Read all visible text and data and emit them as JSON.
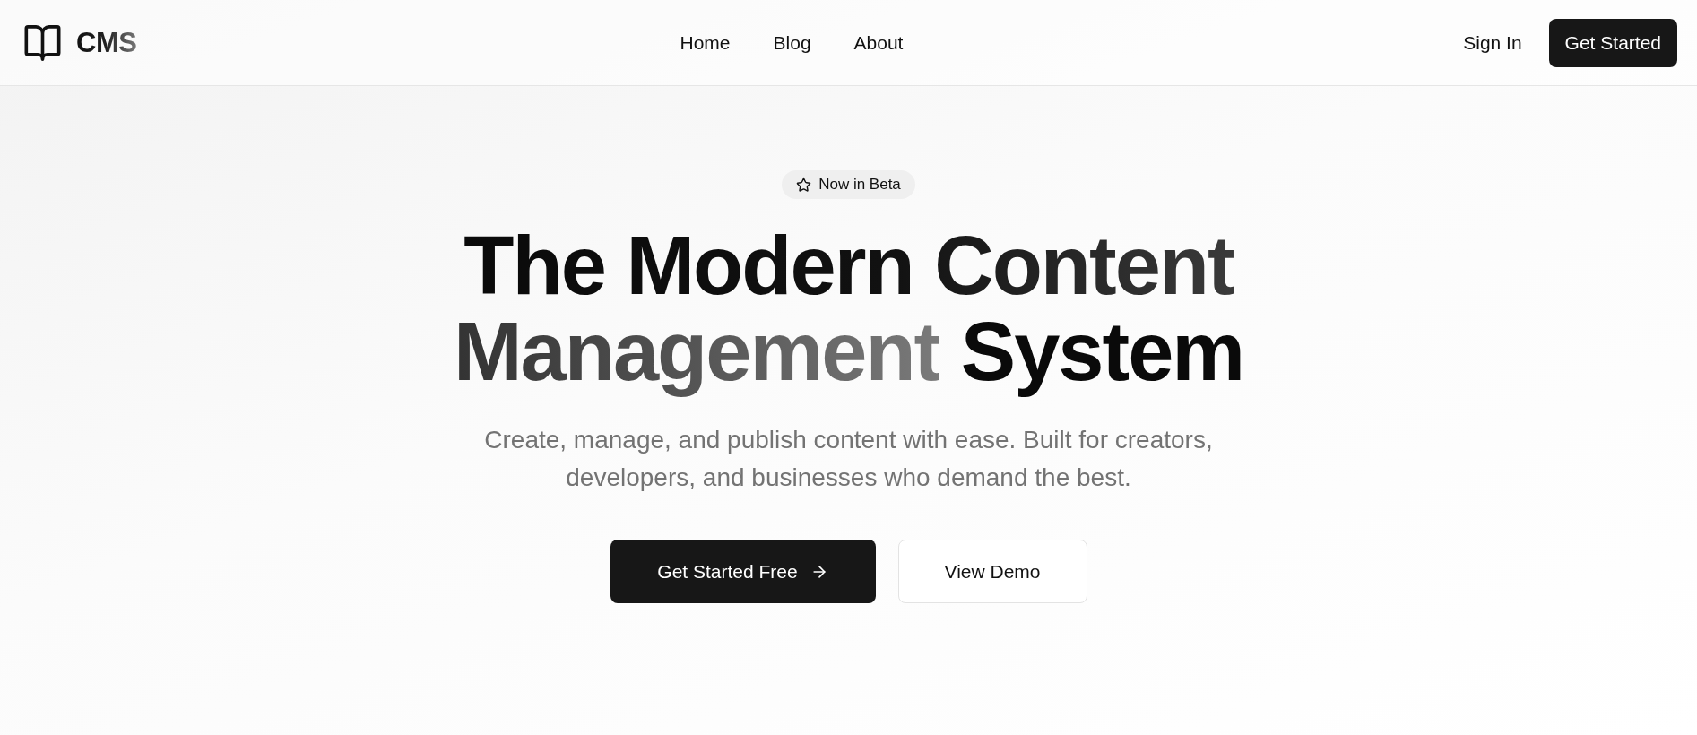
{
  "header": {
    "logo": "CMS",
    "nav": [
      {
        "label": "Home"
      },
      {
        "label": "Blog"
      },
      {
        "label": "About"
      }
    ],
    "sign_in": "Sign In",
    "get_started": "Get Started"
  },
  "hero": {
    "badge": "Now in Beta",
    "heading": [
      [
        {
          "text": "The Modern Content",
          "kind": "dark"
        }
      ],
      [
        {
          "text": "Management",
          "kind": "grey"
        },
        {
          "text": " System",
          "kind": "solid"
        }
      ]
    ],
    "subtitle": "Create, manage, and publish content with ease. Built for creators, developers, and businesses who demand the best.",
    "buttons": [
      {
        "label": "Get Started Free",
        "kind": "primary"
      },
      {
        "label": "View Demo",
        "kind": "outline"
      }
    ]
  }
}
